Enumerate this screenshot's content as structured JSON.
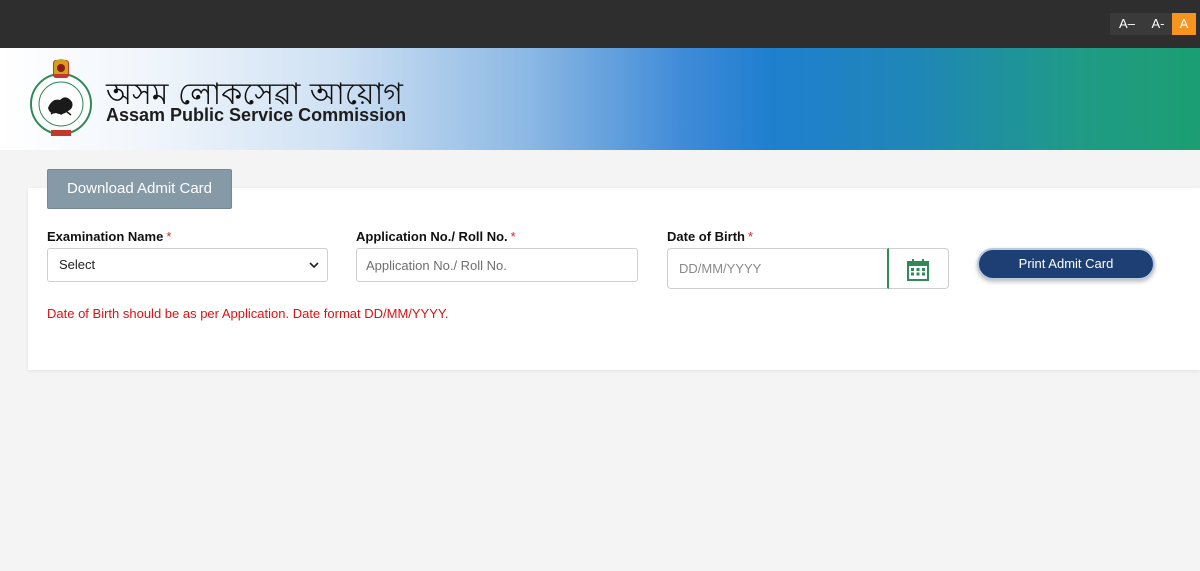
{
  "font_controls": [
    "A–",
    "A-",
    "A"
  ],
  "header": {
    "title_assamese": "অসম লোকসেৱা আয়োগ",
    "title_english": "Assam Public Service Commission",
    "logo_icon": "assam-emblem-icon"
  },
  "tab": {
    "label": "Download Admit Card"
  },
  "form": {
    "exam_label": "Examination Name",
    "exam_selected": "Select",
    "app_label": "Application No./ Roll No.",
    "app_placeholder": "Application No./ Roll No.",
    "dob_label": "Date of Birth",
    "dob_placeholder": "DD/MM/YYYY",
    "required_mark": "*",
    "calendar_icon": "calendar-icon",
    "print_label": "Print Admit Card",
    "note": "Date of Birth should be as per Application. Date format DD/MM/YYYY."
  },
  "colors": {
    "accent": "#1e3f73",
    "tab": "#8699a7",
    "active_font": "#f7941d",
    "error": "#e01010",
    "calendar": "#2e8b57"
  }
}
